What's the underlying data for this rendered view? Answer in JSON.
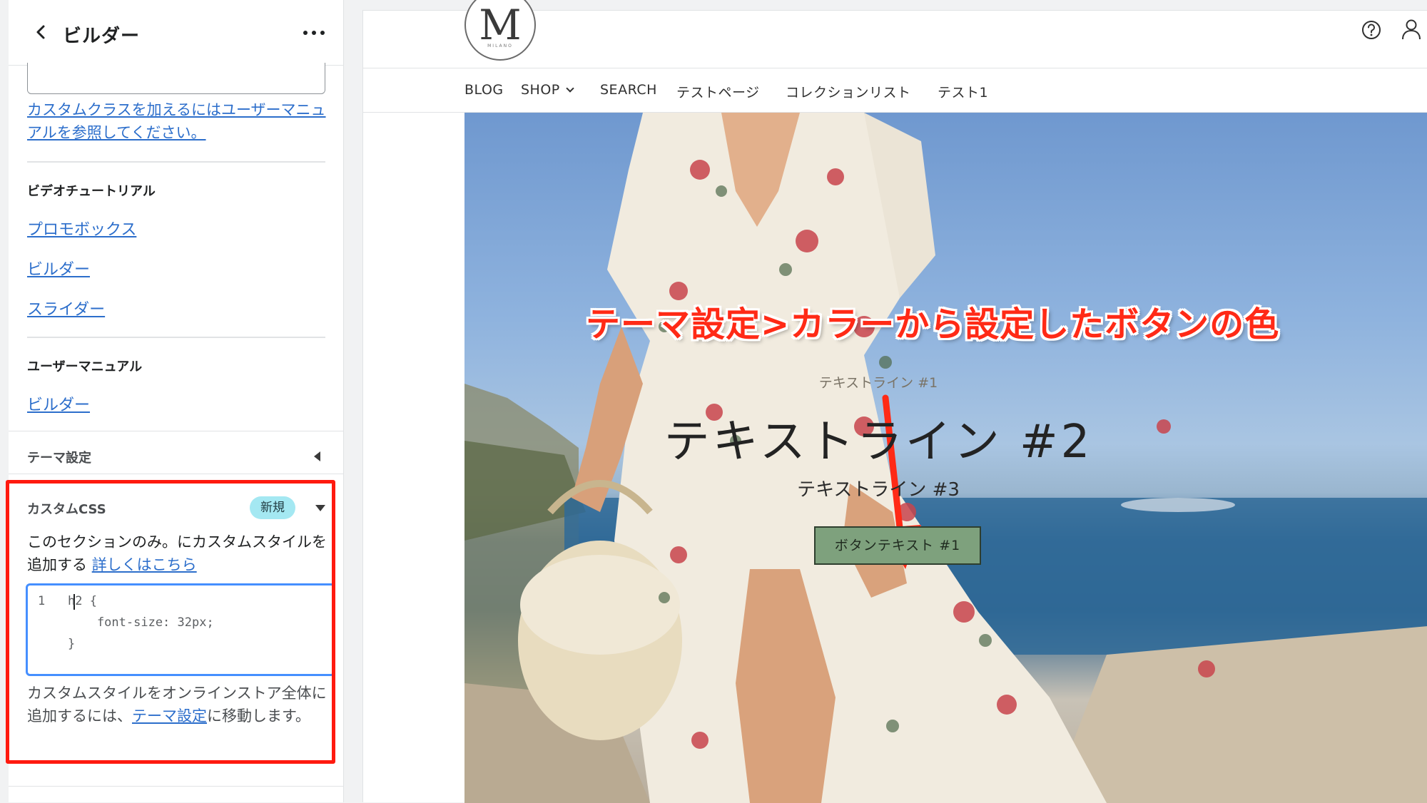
{
  "sidebar": {
    "title": "ビルダー",
    "manual_link": "カスタムクラスを加えるにはユーザーマニュアルを参照してください。",
    "video_section_label": "ビデオチュートリアル",
    "video_links": [
      "プロモボックス",
      "ビルダー",
      "スライダー"
    ],
    "manual_section_label": "ユーザーマニュアル",
    "manual_links": [
      "ビルダー"
    ],
    "theme_settings_label": "テーマ設定",
    "custom_css": {
      "title": "カスタムCSS",
      "badge": "新規",
      "desc_prefix": "このセクションのみ。にカスタムスタイルを追加する",
      "desc_link": "詳しくはこちら",
      "code_lines": [
        {
          "num": "1",
          "text": "h2 {"
        },
        {
          "num": "",
          "text": "    font-size: 32px;"
        },
        {
          "num": "",
          "text": "}"
        }
      ],
      "foot_prefix": "カスタムスタイルをオンラインストア全体に追加するには、",
      "foot_link": "テーマ設定",
      "foot_suffix": "に移動します。"
    }
  },
  "preview": {
    "logo_letter": "M",
    "logo_sub": "MILANO",
    "nav": [
      "BLOG",
      "SHOP",
      "SEARCH",
      "テストページ",
      "コレクションリスト",
      "テスト1"
    ],
    "hero": {
      "text_line_1": "テキストライン #1",
      "text_line_2": "テキストライン #2",
      "text_line_3": "テキストライン #3",
      "button_text": "ボタンテキスト #1"
    },
    "annotation": "テーマ設定>カラーから設定したボタンの色"
  },
  "colors": {
    "accent_red": "#ff1a0f",
    "link_blue": "#2c6ecb",
    "badge_teal": "#a4e8f2",
    "button_green": "#7ea17d"
  },
  "icons": [
    "back-icon",
    "more-icon",
    "help-icon",
    "user-icon",
    "chevron-down-icon",
    "triangle-left-icon",
    "triangle-down-icon"
  ]
}
